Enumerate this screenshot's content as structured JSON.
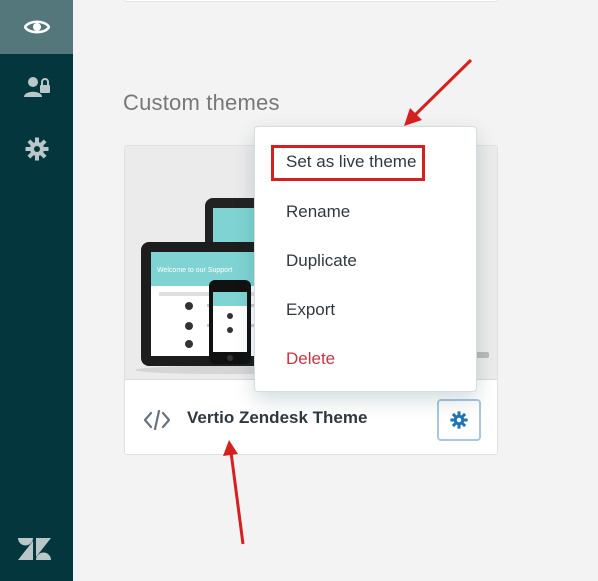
{
  "sidebar": {
    "items": [
      {
        "icon": "eye-icon",
        "active": true
      },
      {
        "icon": "user-lock-icon",
        "active": false
      },
      {
        "icon": "gear-icon",
        "active": false
      }
    ],
    "logo": "zendesk-logo"
  },
  "main": {
    "section_title": "Custom themes",
    "theme": {
      "name": "Vertio Zendesk Theme",
      "code_icon": "code-icon",
      "settings_icon": "gear-icon",
      "preview_banner": "Welcome to our Support"
    }
  },
  "menu": {
    "items": [
      {
        "label": "Set as live theme"
      },
      {
        "label": "Rename"
      },
      {
        "label": "Duplicate"
      },
      {
        "label": "Export"
      },
      {
        "label": "Delete"
      }
    ]
  },
  "colors": {
    "sidebar": "#03363d",
    "sidebar_active": "#54777c",
    "danger": "#cc3340",
    "annotation": "#d62020",
    "link_blue": "#1f73b7"
  }
}
